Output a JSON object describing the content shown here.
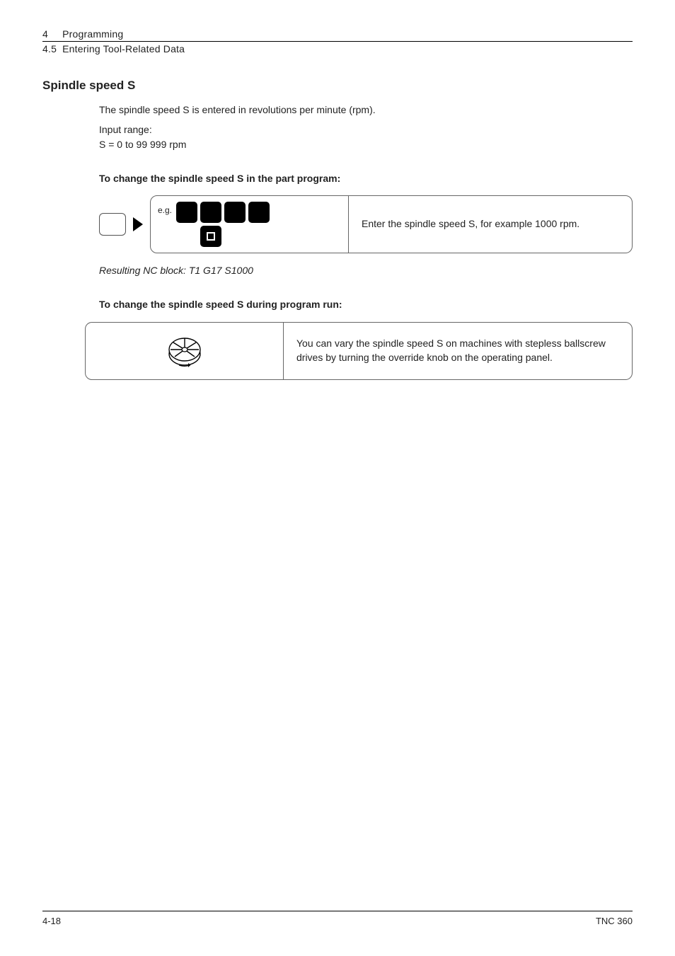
{
  "header": {
    "chapter_num": "4",
    "chapter_title": "Programming",
    "section_num": "4.5",
    "section_title": "Entering Tool-Related Data"
  },
  "section": {
    "heading": "Spindle speed S",
    "intro": "The spindle speed S is entered in revolutions per minute (rpm).",
    "input_range_label": "Input range:",
    "input_range_value": "S = 0 to 99 999 rpm",
    "sub1": {
      "heading": "To change the spindle speed S in the part program:",
      "eg_label": "e.g.",
      "instruction": "Enter the spindle speed S, for example 1000 rpm.",
      "result": "Resulting NC block: T1 G17 S1000"
    },
    "sub2": {
      "heading": "To change the spindle speed S during program run:",
      "instruction": "You can vary the spindle speed S on machines with stepless ballscrew drives by turning the override knob on the operating panel."
    }
  },
  "footer": {
    "left": "4-18",
    "right": "TNC 360"
  }
}
